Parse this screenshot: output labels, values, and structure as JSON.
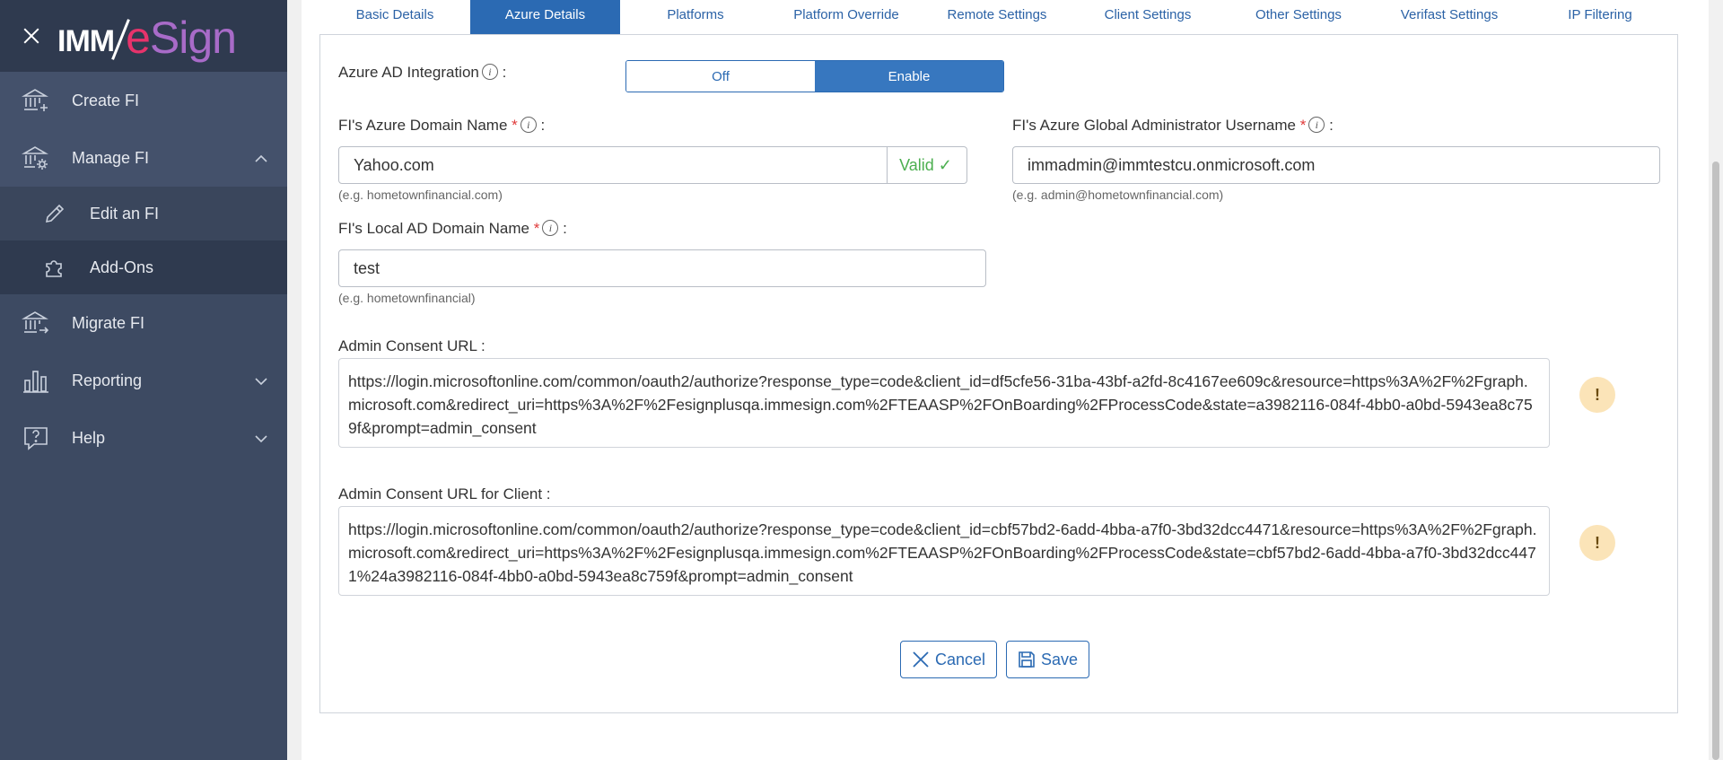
{
  "brand": {
    "prefix": "IMM",
    "name_a": "e",
    "name_b": "Sign"
  },
  "sidebar": {
    "items": [
      {
        "label": "Create FI"
      },
      {
        "label": "Manage FI"
      },
      {
        "label": "Migrate FI"
      },
      {
        "label": "Reporting"
      },
      {
        "label": "Help"
      }
    ],
    "subitems": [
      {
        "label": "Edit an FI"
      },
      {
        "label": "Add-Ons"
      }
    ]
  },
  "tabs": [
    {
      "label": "Basic Details"
    },
    {
      "label": "Azure Details"
    },
    {
      "label": "Platforms"
    },
    {
      "label": "Platform Override"
    },
    {
      "label": "Remote Settings"
    },
    {
      "label": "Client Settings"
    },
    {
      "label": "Other Settings"
    },
    {
      "label": "Verifast Settings"
    },
    {
      "label": "IP Filtering"
    }
  ],
  "form": {
    "azure_ad": {
      "label": "Azure AD Integration",
      "suffix": ":",
      "off": "Off",
      "on": "Enable"
    },
    "domain": {
      "label": "FI's Azure Domain Name",
      "value": "Yahoo.com",
      "valid": "Valid ✓",
      "hint": "(e.g. hometownfinancial.com)"
    },
    "admin_user": {
      "label": "FI's Azure Global Administrator Username",
      "value": "immadmin@immtestcu.onmicrosoft.com",
      "hint": "(e.g. admin@hometownfinancial.com)"
    },
    "local_ad": {
      "label": "FI's Local AD Domain Name",
      "value": "test",
      "hint": "(e.g. hometownfinancial)"
    },
    "consent": {
      "label": "Admin Consent URL :",
      "value": "https://login.microsoftonline.com/common/oauth2/authorize?response_type=code&client_id=df5cfe56-31ba-43bf-a2fd-8c4167ee609c&resource=https%3A%2F%2Fgraph.microsoft.com&redirect_uri=https%3A%2F%2Fesignplusqa.immesign.com%2FTEAASP%2FOnBoarding%2FProcessCode&state=a3982116-084f-4bb0-a0bd-5943ea8c759f&prompt=admin_consent"
    },
    "consent_client": {
      "label": "Admin Consent URL for Client :",
      "value": "https://login.microsoftonline.com/common/oauth2/authorize?response_type=code&client_id=cbf57bd2-6add-4bba-a7f0-3bd32dcc4471&resource=https%3A%2F%2Fgraph.microsoft.com&redirect_uri=https%3A%2F%2Fesignplusqa.immesign.com%2FTEAASP%2FOnBoarding%2FProcessCode&state=cbf57bd2-6add-4bba-a7f0-3bd32dcc4471%24a3982116-084f-4bb0-a0bd-5943ea8c759f&prompt=admin_consent"
    },
    "req_mark": "*",
    "colon": ":",
    "info_glyph": "i",
    "warn_glyph": "!"
  },
  "actions": {
    "cancel": "Cancel",
    "save": "Save"
  },
  "colors": {
    "sidebar": "#3d4a62",
    "accent": "#2b6ab3",
    "valid": "#4caf50",
    "required": "#e03a3a"
  }
}
